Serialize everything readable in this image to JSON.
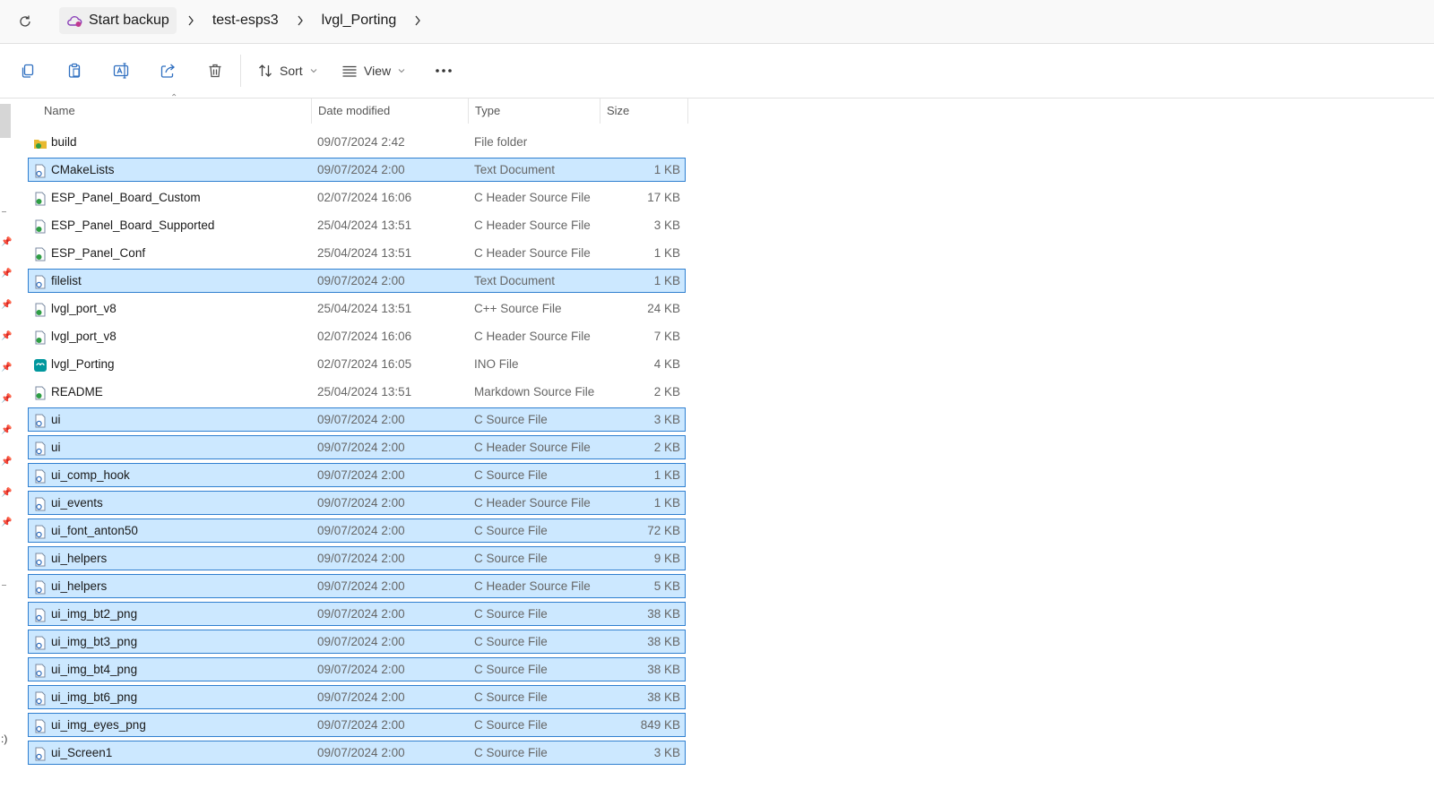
{
  "breadcrumb": [
    "Start backup",
    "test-esps3",
    "lvgl_Porting"
  ],
  "toolbar": {
    "sort_label": "Sort",
    "view_label": "View"
  },
  "columns": {
    "name": "Name",
    "date": "Date modified",
    "type": "Type",
    "size": "Size"
  },
  "files": [
    {
      "name": "build",
      "date": "09/07/2024 2:42",
      "type": "File folder",
      "size": "",
      "selected": false,
      "icon": "folder-icon"
    },
    {
      "name": "CMakeLists",
      "date": "09/07/2024 2:00",
      "type": "Text Document",
      "size": "1 KB",
      "selected": true,
      "icon": "document-icon"
    },
    {
      "name": "ESP_Panel_Board_Custom",
      "date": "02/07/2024 16:06",
      "type": "C Header Source File",
      "size": "17 KB",
      "selected": false,
      "icon": "header-file-icon"
    },
    {
      "name": "ESP_Panel_Board_Supported",
      "date": "25/04/2024 13:51",
      "type": "C Header Source File",
      "size": "3 KB",
      "selected": false,
      "icon": "header-file-icon"
    },
    {
      "name": "ESP_Panel_Conf",
      "date": "25/04/2024 13:51",
      "type": "C Header Source File",
      "size": "1 KB",
      "selected": false,
      "icon": "header-file-icon"
    },
    {
      "name": "filelist",
      "date": "09/07/2024 2:00",
      "type": "Text Document",
      "size": "1 KB",
      "selected": true,
      "icon": "document-icon"
    },
    {
      "name": "lvgl_port_v8",
      "date": "25/04/2024 13:51",
      "type": "C++ Source File",
      "size": "24 KB",
      "selected": false,
      "icon": "source-file-icon"
    },
    {
      "name": "lvgl_port_v8",
      "date": "02/07/2024 16:06",
      "type": "C Header Source File",
      "size": "7 KB",
      "selected": false,
      "icon": "header-file-icon"
    },
    {
      "name": "lvgl_Porting",
      "date": "02/07/2024 16:05",
      "type": "INO File",
      "size": "4 KB",
      "selected": false,
      "icon": "arduino-file-icon"
    },
    {
      "name": "README",
      "date": "25/04/2024 13:51",
      "type": "Markdown Source File",
      "size": "2 KB",
      "selected": false,
      "icon": "markdown-file-icon"
    },
    {
      "name": "ui",
      "date": "09/07/2024 2:00",
      "type": "C Source File",
      "size": "3 KB",
      "selected": true,
      "icon": "document-icon"
    },
    {
      "name": "ui",
      "date": "09/07/2024 2:00",
      "type": "C Header Source File",
      "size": "2 KB",
      "selected": true,
      "icon": "document-icon"
    },
    {
      "name": "ui_comp_hook",
      "date": "09/07/2024 2:00",
      "type": "C Source File",
      "size": "1 KB",
      "selected": true,
      "icon": "document-icon"
    },
    {
      "name": "ui_events",
      "date": "09/07/2024 2:00",
      "type": "C Header Source File",
      "size": "1 KB",
      "selected": true,
      "icon": "document-icon"
    },
    {
      "name": "ui_font_anton50",
      "date": "09/07/2024 2:00",
      "type": "C Source File",
      "size": "72 KB",
      "selected": true,
      "icon": "document-icon"
    },
    {
      "name": "ui_helpers",
      "date": "09/07/2024 2:00",
      "type": "C Source File",
      "size": "9 KB",
      "selected": true,
      "icon": "document-icon"
    },
    {
      "name": "ui_helpers",
      "date": "09/07/2024 2:00",
      "type": "C Header Source File",
      "size": "5 KB",
      "selected": true,
      "icon": "document-icon"
    },
    {
      "name": "ui_img_bt2_png",
      "date": "09/07/2024 2:00",
      "type": "C Source File",
      "size": "38 KB",
      "selected": true,
      "icon": "document-icon"
    },
    {
      "name": "ui_img_bt3_png",
      "date": "09/07/2024 2:00",
      "type": "C Source File",
      "size": "38 KB",
      "selected": true,
      "icon": "document-icon"
    },
    {
      "name": "ui_img_bt4_png",
      "date": "09/07/2024 2:00",
      "type": "C Source File",
      "size": "38 KB",
      "selected": true,
      "icon": "document-icon"
    },
    {
      "name": "ui_img_bt6_png",
      "date": "09/07/2024 2:00",
      "type": "C Source File",
      "size": "38 KB",
      "selected": true,
      "icon": "document-icon"
    },
    {
      "name": "ui_img_eyes_png",
      "date": "09/07/2024 2:00",
      "type": "C Source File",
      "size": "849 KB",
      "selected": true,
      "icon": "document-icon"
    },
    {
      "name": "ui_Screen1",
      "date": "09/07/2024 2:00",
      "type": "C Source File",
      "size": "3 KB",
      "selected": true,
      "icon": "document-icon"
    }
  ],
  "colors": {
    "selection_fill": "#cce8ff",
    "selection_border": "#2f7fd0",
    "accent_green": "#2e9e44",
    "accent_blue": "#2f6fc0",
    "accent_teal": "#00979d",
    "folder_yellow": "#e8b930"
  }
}
